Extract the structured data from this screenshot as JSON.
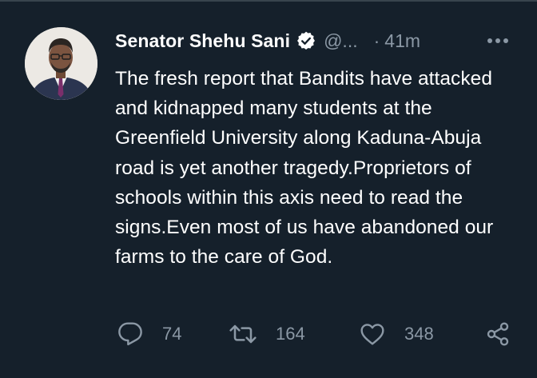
{
  "tweet": {
    "display_name": "Senator Shehu Sani",
    "handle": "@...",
    "separator": "·",
    "time": "41m",
    "text": "The fresh report that Bandits have attacked and kidnapped many students at the Greenfield University along Kaduna-Abuja road is yet another tragedy.Proprietors of schools within this axis need to read the signs.Even most of us have abandoned our farms to the care of God.",
    "verified": true,
    "avatar_icon": "profile-photo",
    "more_icon": "more-horizontal-icon"
  },
  "actions": {
    "reply": {
      "icon": "reply-icon",
      "count": "74"
    },
    "retweet": {
      "icon": "retweet-icon",
      "count": "164"
    },
    "like": {
      "icon": "heart-icon",
      "count": "348"
    },
    "share": {
      "icon": "share-icon"
    }
  },
  "colors": {
    "background": "#15202b",
    "primary_text": "#ffffff",
    "secondary_text": "#8b98a5",
    "divider": "#38444d"
  }
}
